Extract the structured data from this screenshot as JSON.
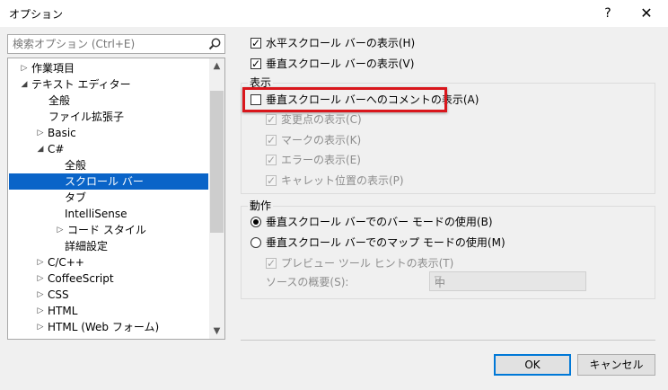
{
  "window": {
    "title": "オプション",
    "help": "?",
    "close": "✕"
  },
  "search": {
    "placeholder": "検索オプション (Ctrl+E)"
  },
  "tree": {
    "items": [
      {
        "label": "作業項目",
        "arrow": "▷"
      },
      {
        "label": "テキスト エディター",
        "arrow": "◢"
      },
      {
        "label": "全般"
      },
      {
        "label": "ファイル拡張子"
      },
      {
        "label": "Basic",
        "arrow": "▷"
      },
      {
        "label": "C#",
        "arrow": "◢"
      },
      {
        "label": "全般"
      },
      {
        "label": "スクロール バー",
        "selected": true
      },
      {
        "label": "タブ"
      },
      {
        "label": "IntelliSense"
      },
      {
        "label": "コード スタイル",
        "arrow": "▷"
      },
      {
        "label": "詳細設定"
      },
      {
        "label": "C/C++",
        "arrow": "▷"
      },
      {
        "label": "CoffeeScript",
        "arrow": "▷"
      },
      {
        "label": "CSS",
        "arrow": "▷"
      },
      {
        "label": "HTML",
        "arrow": "▷"
      },
      {
        "label": "HTML (Web フォーム)",
        "arrow": "▷"
      }
    ]
  },
  "scrollbars": {
    "horizontal": {
      "label": "水平スクロール バーの表示(H)",
      "checked": true
    },
    "vertical": {
      "label": "垂直スクロール バーの表示(V)",
      "checked": true
    }
  },
  "display": {
    "group_label": "表示",
    "annotations": {
      "label": "垂直スクロール バーへのコメントの表示(A)",
      "checked": false
    },
    "changes": {
      "label": "変更点の表示(C)",
      "checked": true
    },
    "marks": {
      "label": "マークの表示(K)",
      "checked": true
    },
    "errors": {
      "label": "エラーの表示(E)",
      "checked": true
    },
    "caret": {
      "label": "キャレット位置の表示(P)",
      "checked": true
    }
  },
  "behavior": {
    "group_label": "動作",
    "bar_mode": {
      "label": "垂直スクロール バーでのバー モードの使用(B)",
      "selected": true
    },
    "map_mode": {
      "label": "垂直スクロール バーでのマップ モードの使用(M)",
      "selected": false
    },
    "preview": {
      "label": "プレビュー ツール ヒントの表示(T)",
      "checked": true
    },
    "overview_label": "ソースの概要(S):",
    "overview_value": "中"
  },
  "buttons": {
    "ok": "OK",
    "cancel": "キャンセル"
  },
  "colors": {
    "selection": "#0a64c8",
    "highlight": "#d9161c",
    "ok_border": "#0078d7"
  }
}
